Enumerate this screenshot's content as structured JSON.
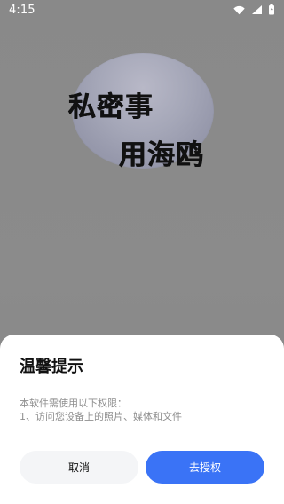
{
  "status_bar": {
    "time": "4:15",
    "icons": [
      "wifi-icon",
      "cellular-icon",
      "battery-icon"
    ]
  },
  "splash": {
    "line1": "私密事",
    "line2": "用海鸥"
  },
  "dialog": {
    "title": "温馨提示",
    "body_lines": [
      "本软件需使用以下权限：",
      "1、访问您设备上的照片、媒体和文件"
    ],
    "buttons": {
      "cancel": "取消",
      "confirm": "去授权"
    }
  },
  "colors": {
    "overlay_gray": "#8a8a8a",
    "dialog_bg": "#ffffff",
    "confirm_blue": "#3a73f6",
    "cancel_bg": "#f4f5f7",
    "body_text": "#8f8f8f",
    "title_text": "#111111"
  }
}
